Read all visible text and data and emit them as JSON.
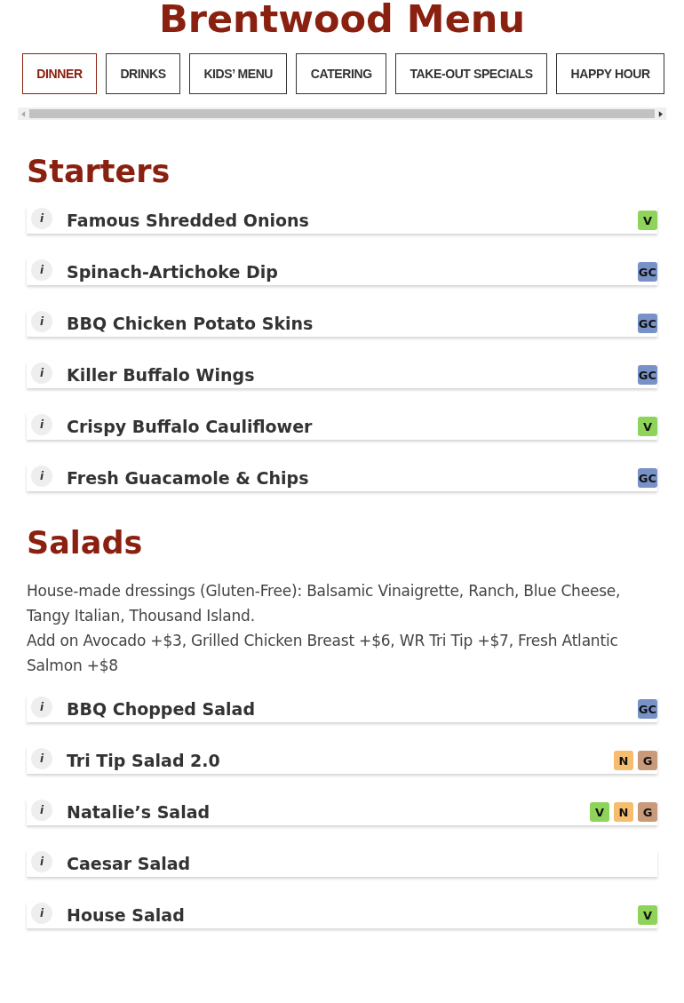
{
  "title": "Brentwood Menu",
  "tabs": [
    {
      "label": "DINNER",
      "selected": true
    },
    {
      "label": "DRINKS",
      "selected": false
    },
    {
      "label": "KIDS’ MENU",
      "selected": false
    },
    {
      "label": "CATERING",
      "selected": false
    },
    {
      "label": "TAKE-OUT SPECIALS",
      "selected": false
    },
    {
      "label": "HAPPY HOUR",
      "selected": false
    }
  ],
  "sections": [
    {
      "heading": "Starters",
      "items": [
        {
          "info": "i",
          "name": "Famous Shredded Onions",
          "tags": [
            {
              "label": "V",
              "color": "#8fd45a"
            }
          ]
        },
        {
          "info": "i",
          "name": "Spinach-Artichoke Dip",
          "tags": [
            {
              "label": "GC",
              "color": "#7892c8"
            }
          ]
        },
        {
          "info": "i",
          "name": "BBQ Chicken Potato Skins",
          "tags": [
            {
              "label": "GC",
              "color": "#7892c8"
            }
          ]
        },
        {
          "info": "i",
          "name": "Killer Buffalo Wings",
          "tags": [
            {
              "label": "GC",
              "color": "#7892c8"
            }
          ]
        },
        {
          "info": "i",
          "name": "Crispy Buffalo Cauliflower",
          "tags": [
            {
              "label": "V",
              "color": "#8fd45a"
            }
          ]
        },
        {
          "info": "i",
          "name": "Fresh Guacamole & Chips",
          "tags": [
            {
              "label": "GC",
              "color": "#7892c8"
            }
          ]
        }
      ]
    },
    {
      "heading": "Salads",
      "notes": [
        "House-made dressings (Gluten-Free): Balsamic Vinaigrette, Ranch, Blue Cheese, Tangy Italian, Thousand Island.",
        "Add on Avocado +$3, Grilled Chicken Breast +$6, WR Tri Tip +$7, Fresh Atlantic Salmon +$8"
      ],
      "items": [
        {
          "info": "i",
          "name": "BBQ Chopped Salad",
          "tags": [
            {
              "label": "GC",
              "color": "#7892c8"
            }
          ]
        },
        {
          "info": "i",
          "name": "Tri Tip Salad 2.0",
          "tags": [
            {
              "label": "N",
              "color": "#f7bd6e"
            },
            {
              "label": "G",
              "color": "#c99a7a"
            }
          ]
        },
        {
          "info": "i",
          "name": "Natalie’s Salad",
          "tags": [
            {
              "label": "V",
              "color": "#8fd45a"
            },
            {
              "label": "N",
              "color": "#f7bd6e"
            },
            {
              "label": "G",
              "color": "#c99a7a"
            }
          ]
        },
        {
          "info": "i",
          "name": "Caesar Salad"
        },
        {
          "info": "i",
          "name": "House Salad",
          "tags": [
            {
              "label": "V",
              "color": "#8fd45a"
            }
          ]
        }
      ]
    }
  ]
}
